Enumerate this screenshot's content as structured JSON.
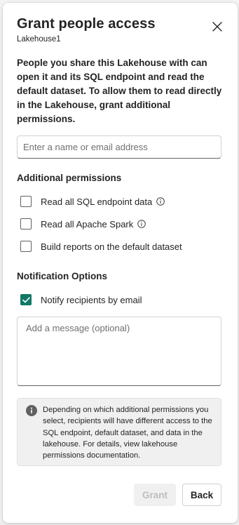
{
  "dialog": {
    "title": "Grant people access",
    "subtitle": "Lakehouse1",
    "close_icon": "close-icon",
    "description": "People you share this Lakehouse with can open it and its SQL endpoint and read the default dataset. To allow them to read directly in the Lakehouse, grant additional permissions."
  },
  "search": {
    "placeholder": "Enter a name or email address",
    "value": ""
  },
  "permissions": {
    "heading": "Additional permissions",
    "items": [
      {
        "label": "Read all SQL endpoint data",
        "checked": false,
        "info_icon": "info-icon"
      },
      {
        "label": "Read all Apache Spark",
        "checked": false,
        "info_icon": "info-icon"
      },
      {
        "label": "Build reports on the default dataset",
        "checked": false
      }
    ]
  },
  "notification": {
    "heading": "Notification Options",
    "notify_label": "Notify recipients by email",
    "notify_checked": true,
    "message_placeholder": "Add a message (optional)",
    "message_value": ""
  },
  "notice": {
    "icon": "info-filled-icon",
    "text": "Depending on which additional permissions you select, recipients will have different access to the SQL endpoint, default dataset, and data in the lakehouse. For details, view lakehouse permissions documentation."
  },
  "buttons": {
    "grant_label": "Grant",
    "grant_disabled": true,
    "back_label": "Back"
  },
  "colors": {
    "accent": "#117865",
    "text": "#242424",
    "placeholder": "#707070",
    "disabled_text": "#bdbdbd"
  }
}
